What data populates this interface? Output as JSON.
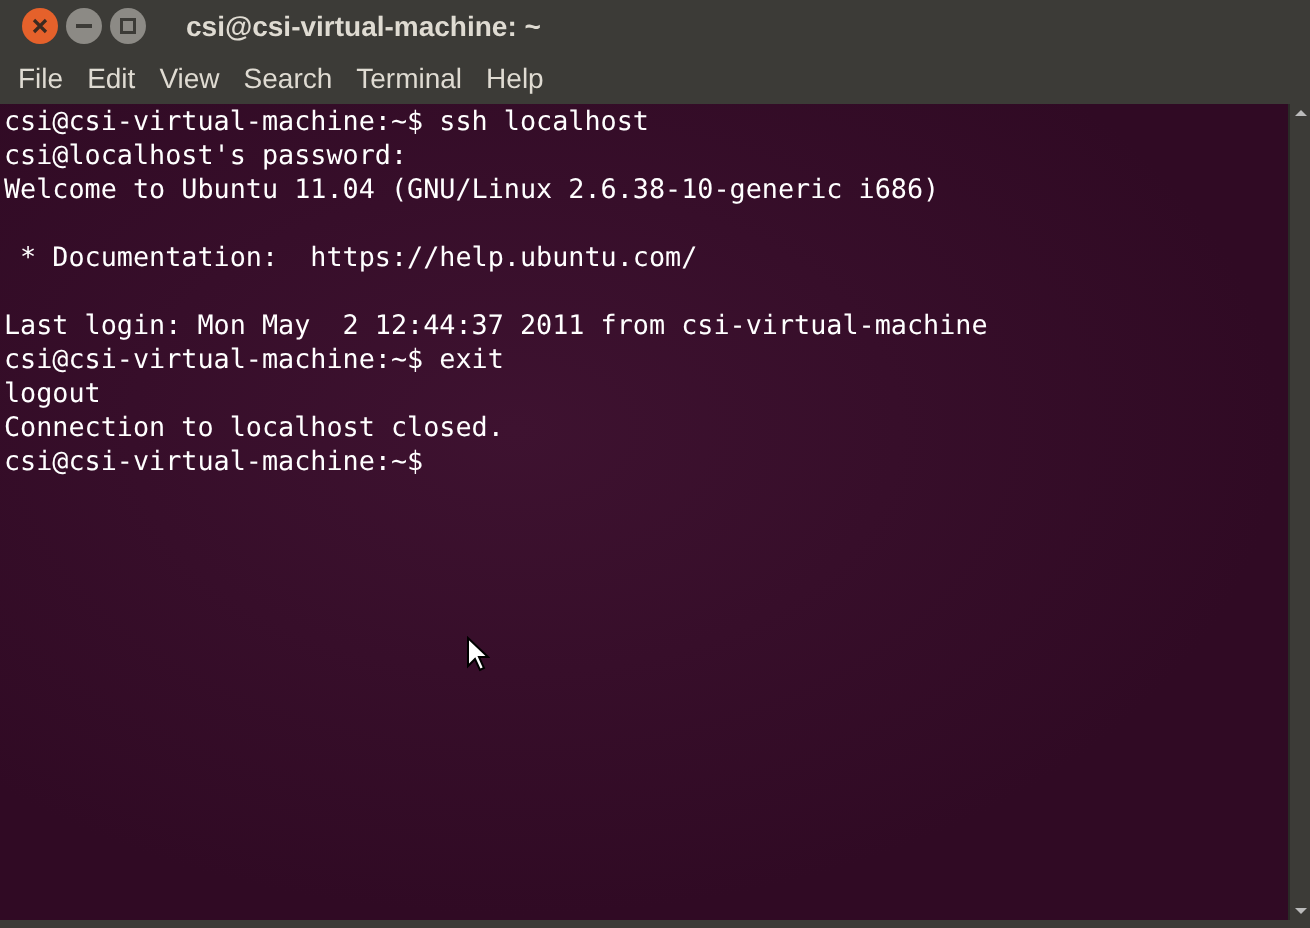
{
  "window": {
    "title": "csi@csi-virtual-machine: ~"
  },
  "menu": [
    "File",
    "Edit",
    "View",
    "Search",
    "Terminal",
    "Help"
  ],
  "terminal": {
    "lines": [
      {
        "kind": "text",
        "text": "csi@csi-virtual-machine:~$ ssh localhost"
      },
      {
        "kind": "text",
        "text": "csi@localhost's password:"
      },
      {
        "kind": "text",
        "text": "Welcome to Ubuntu 11.04 (GNU/Linux 2.6.38-10-generic i686)"
      },
      {
        "kind": "blank"
      },
      {
        "kind": "text",
        "text": " * Documentation:  https://help.ubuntu.com/"
      },
      {
        "kind": "blank"
      },
      {
        "kind": "text",
        "text": "Last login: Mon May  2 12:44:37 2011 from csi-virtual-machine"
      },
      {
        "kind": "text",
        "text": "csi@csi-virtual-machine:~$ exit"
      },
      {
        "kind": "text",
        "text": "logout"
      },
      {
        "kind": "text",
        "text": "Connection to localhost closed."
      },
      {
        "kind": "text",
        "text": "csi@csi-virtual-machine:~$"
      }
    ]
  }
}
